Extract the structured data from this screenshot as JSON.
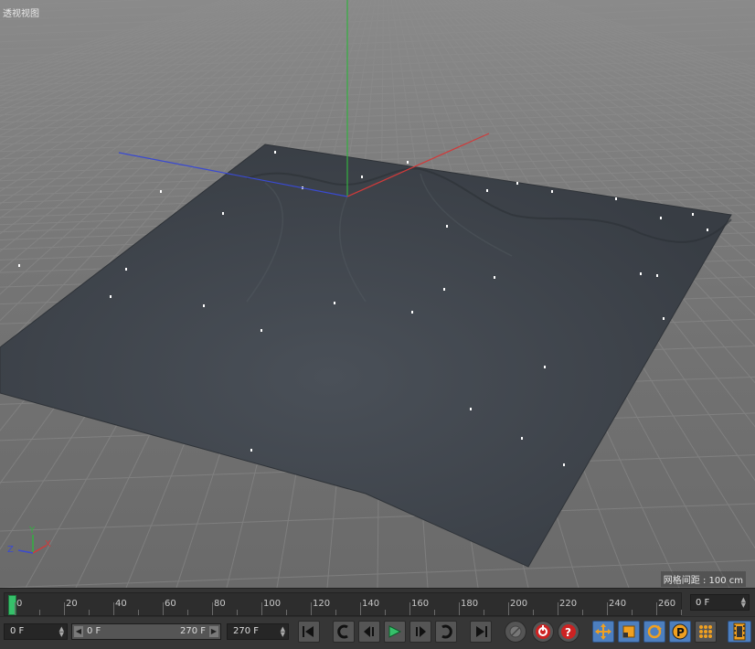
{
  "viewport": {
    "title": "透视视图",
    "grid_spacing_label": "网格间距 : 100 cm",
    "axes": {
      "x": "X",
      "y": "Y",
      "z": "Z"
    }
  },
  "timeline": {
    "ticks": [
      "0",
      "20",
      "40",
      "60",
      "80",
      "100",
      "120",
      "140",
      "160",
      "180",
      "200",
      "220",
      "240",
      "260"
    ],
    "current_frame_display": "0 F"
  },
  "toolbar": {
    "start_frame": "0 F",
    "range_min": "0 F",
    "range_max": "270 F",
    "end_frame": "270 F",
    "transport": [
      "go-to-start-icon",
      "prev-key-icon",
      "step-back-icon",
      "play-icon",
      "step-forward-icon",
      "next-key-icon",
      "go-to-end-icon"
    ],
    "record": [
      "record-disabled-icon",
      "autokey-icon",
      "keyframe-selection-icon"
    ],
    "key_types": [
      "move-key-icon",
      "scale-key-icon",
      "rotate-key-icon",
      "param-key-icon",
      "point-level-icon"
    ],
    "timeline_window": "film-strip-icon"
  },
  "colors": {
    "viewport_bg": "#7a7a7a",
    "terrain": "#404650",
    "axis_x": "#d03a3a",
    "axis_y": "#33b040",
    "axis_z": "#3a4ad0",
    "playhead": "#36c06a",
    "accent_blue": "#4d7fbf"
  }
}
